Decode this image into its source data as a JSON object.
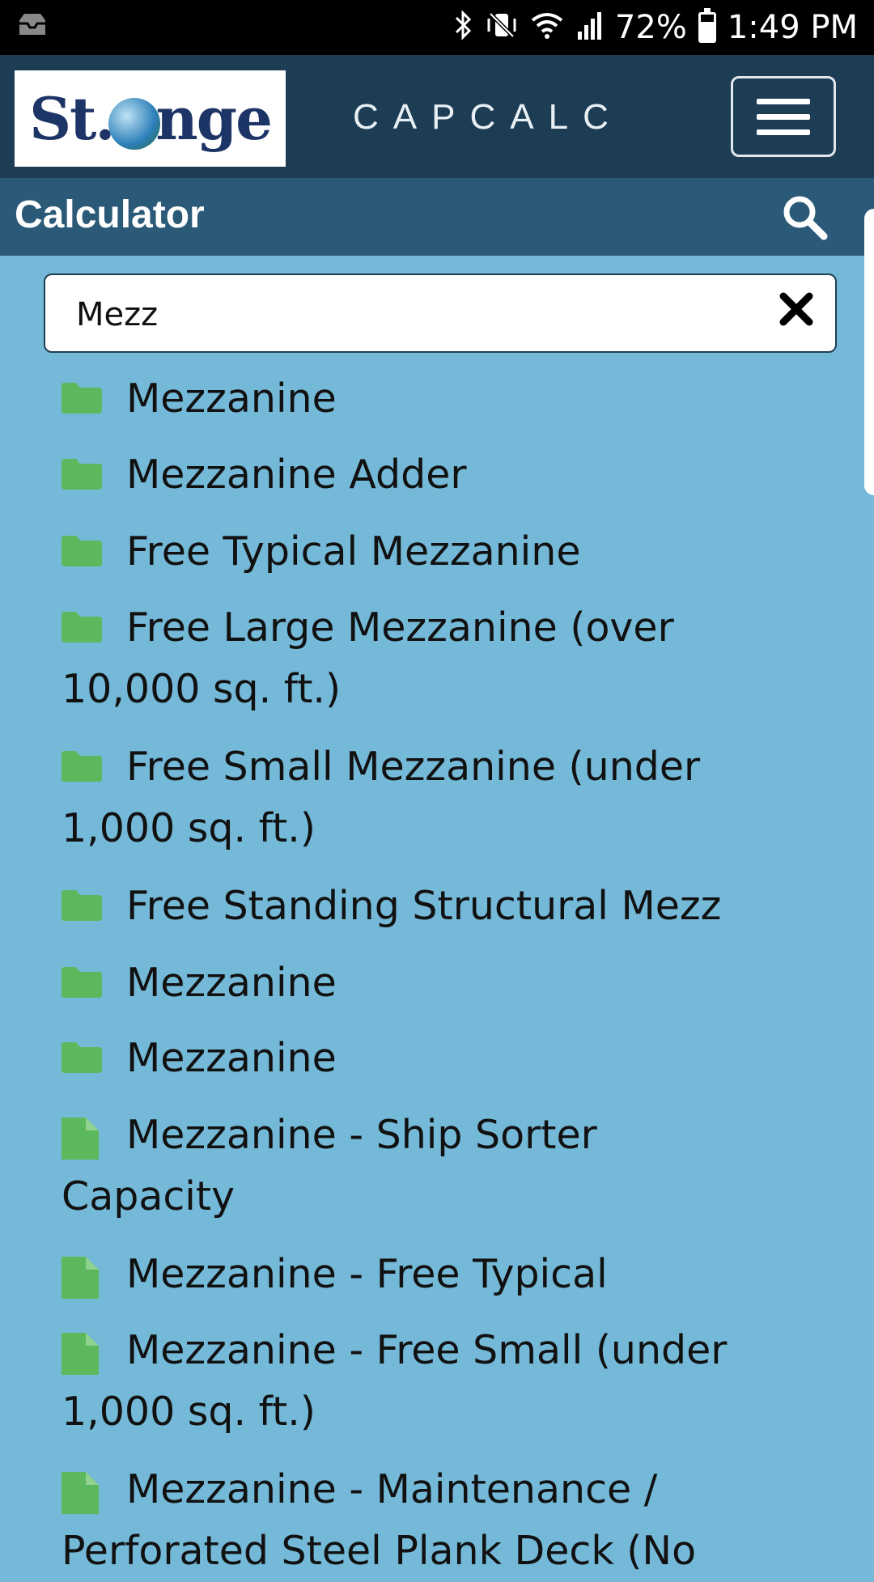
{
  "status_bar": {
    "battery_percent": "72%",
    "time": "1:49 PM",
    "battery_level": 0.72
  },
  "header": {
    "logo_text": "St.Onge",
    "app_title": "CAPCALC"
  },
  "section": {
    "title": "Calculator"
  },
  "search": {
    "value": "Mezz"
  },
  "results": [
    {
      "label": "Mezzanine",
      "type": "folder"
    },
    {
      "label": "Mezzanine Adder",
      "type": "folder"
    },
    {
      "label": "Free Typical Mezzanine",
      "type": "folder"
    },
    {
      "label": "Free Large Mezzanine (over 10,000 sq. ft.)",
      "type": "folder"
    },
    {
      "label": "Free Small Mezzanine (under 1,000 sq. ft.)",
      "type": "folder"
    },
    {
      "label": "Free Standing Structural Mezz",
      "type": "folder"
    },
    {
      "label": "Mezzanine",
      "type": "folder"
    },
    {
      "label": "Mezzanine",
      "type": "folder",
      "selected": true
    },
    {
      "label": "Mezzanine - Ship Sorter Capacity",
      "type": "file"
    },
    {
      "label": "Mezzanine - Free Typical",
      "type": "file"
    },
    {
      "label": "Mezzanine - Free Small (under 1,000 sq. ft.)",
      "type": "file"
    },
    {
      "label": "Mezzanine - Maintenance / Perforated Steel Plank Deck (No",
      "type": "file"
    }
  ],
  "colors": {
    "header_bg": "#1d3d55",
    "section_bg": "#2b5a78",
    "content_bg": "#75b9d8",
    "icon_green": "#5cb85c"
  }
}
